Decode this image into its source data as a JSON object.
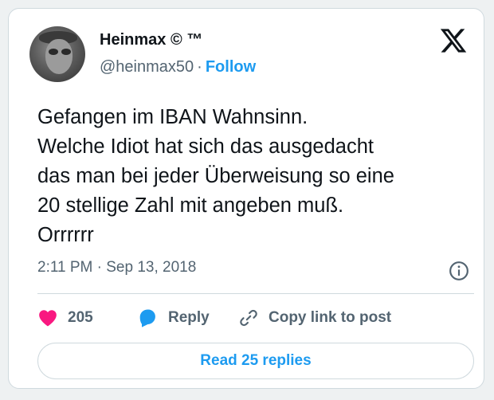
{
  "author": {
    "name": "Heinmax",
    "name_suffix": "© ™",
    "handle": "@heinmax50",
    "separator": "·",
    "follow_label": "Follow"
  },
  "tweet": {
    "lines": [
      "Gefangen im IBAN Wahnsinn.",
      "Welche Idiot hat sich das ausgedacht",
      "das man bei jeder Überweisung so eine",
      "20 stellige Zahl mit angeben muß.",
      "Orrrrrr"
    ]
  },
  "meta": {
    "time": "2:11 PM",
    "separator": "·",
    "date": "Sep 13, 2018"
  },
  "actions": {
    "like_count": "205",
    "reply_label": "Reply",
    "copy_label": "Copy link to post"
  },
  "read_replies_label": "Read 25 replies",
  "icons": {
    "brand": "x-logo-icon",
    "info": "info-icon",
    "like": "heart-icon",
    "reply": "speech-bubble-icon",
    "copy": "link-icon"
  },
  "colors": {
    "accent": "#1d9bf0",
    "like": "#f91880",
    "muted": "#536471",
    "text": "#0f1419",
    "border": "#cfd9de"
  }
}
